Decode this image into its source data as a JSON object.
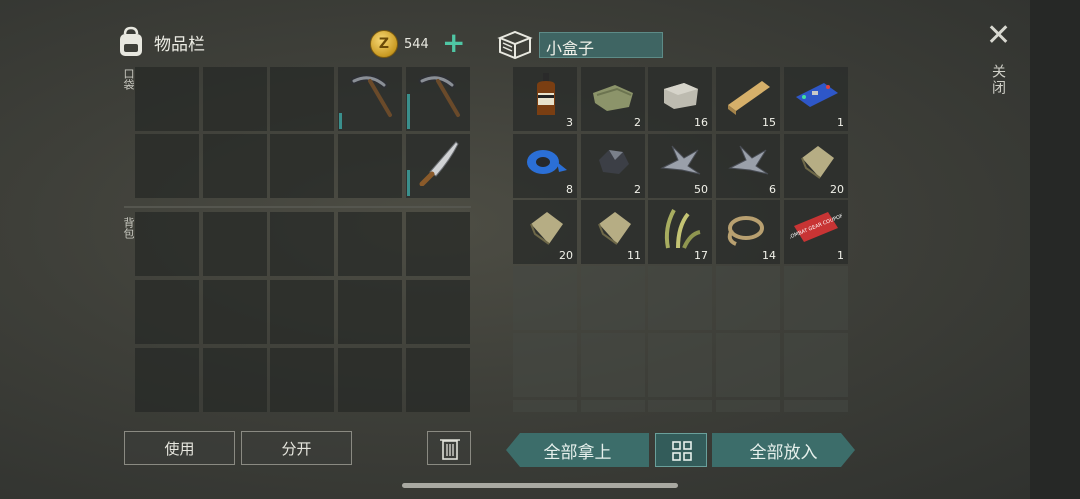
{
  "inventory": {
    "title": "物品栏",
    "coins": "544",
    "pocket_label": "口袋",
    "backpack_label": "背包"
  },
  "container": {
    "name": "小盒子",
    "items": [
      {
        "name": "whiskey-bottle",
        "count": "3"
      },
      {
        "name": "cloth",
        "count": "2"
      },
      {
        "name": "stone",
        "count": "16"
      },
      {
        "name": "wood-plank",
        "count": "15"
      },
      {
        "name": "circuit-board",
        "count": "1"
      },
      {
        "name": "blue-tape",
        "count": "8"
      },
      {
        "name": "coal",
        "count": "2"
      },
      {
        "name": "metal-scrap",
        "count": "50"
      },
      {
        "name": "metal-scrap",
        "count": "6"
      },
      {
        "name": "fabric-rag",
        "count": "20"
      },
      {
        "name": "fabric-rag",
        "count": "20"
      },
      {
        "name": "fabric-rag",
        "count": "11"
      },
      {
        "name": "plant-fiber",
        "count": "17"
      },
      {
        "name": "rope",
        "count": "14"
      },
      {
        "name": "combat-gear-coupon",
        "count": "1",
        "coupon_text": "COMBAT GEAR COUPON"
      }
    ]
  },
  "pocket_items": [
    {
      "name": "pickaxe",
      "durability": 0.25
    },
    {
      "name": "pickaxe",
      "durability": 0.55
    },
    {
      "name": "machete",
      "durability": 0.4
    }
  ],
  "buttons": {
    "use": "使用",
    "split": "分开",
    "take_all": "全部拿上",
    "put_all": "全部放入",
    "close": "关闭"
  },
  "colors": {
    "accent": "#4fc6a4",
    "teal_button": "#3c6d6a",
    "durability": "#3a8f8c"
  }
}
